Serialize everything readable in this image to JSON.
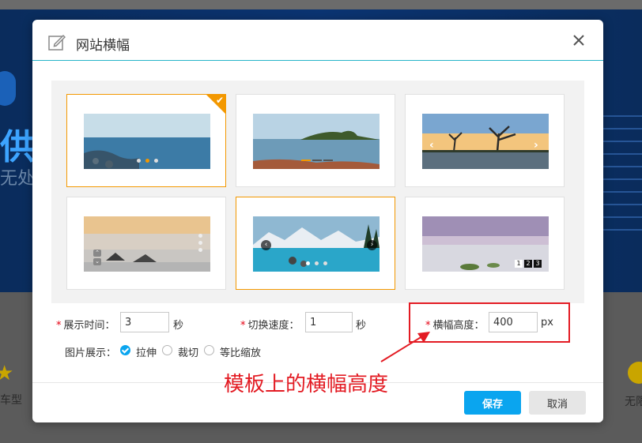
{
  "background": {
    "big_char": "供",
    "small_char": "无处",
    "left_text": "车型",
    "right_text": "无限"
  },
  "dialog": {
    "title": "网站横幅",
    "close_label": "✕",
    "templates": [
      {
        "name": "template-1",
        "selected": true,
        "indicator": "dots"
      },
      {
        "name": "template-2",
        "selected": false,
        "indicator": "bars"
      },
      {
        "name": "template-3",
        "selected": false,
        "indicator": "arrows"
      },
      {
        "name": "template-4",
        "selected": false,
        "indicator": "vertical-dots"
      },
      {
        "name": "template-5",
        "selected": false,
        "indicator": "round-arrows"
      },
      {
        "name": "template-6",
        "selected": false,
        "indicator": "numbers"
      }
    ],
    "form": {
      "display_time_label": "展示时间：",
      "display_time_value": "3",
      "display_time_unit": "秒",
      "switch_speed_label": "切换速度：",
      "switch_speed_value": "1",
      "switch_speed_unit": "秒",
      "banner_height_label": "横幅高度：",
      "banner_height_value": "400",
      "banner_height_unit": "px",
      "required_mark": "*",
      "image_display_label": "图片展示：",
      "image_display_options": [
        "拉伸",
        "裁切",
        "等比缩放"
      ],
      "image_display_selected": "拉伸"
    },
    "annotation": "模板上的横幅高度",
    "save_label": "保存",
    "cancel_label": "取消"
  },
  "colors": {
    "accent": "#0aa5ef",
    "selected_border": "#f39800",
    "header_line": "#26b4c9",
    "annotation_red": "#e31b23"
  }
}
